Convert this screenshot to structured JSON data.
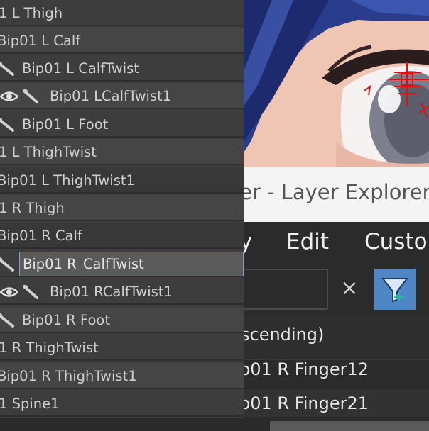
{
  "tree": {
    "rows": [
      {
        "label": "1 L Thigh"
      },
      {
        "label": "Bip01 L Calf"
      },
      {
        "label": "Bip01 L CalfTwist"
      },
      {
        "label": "Bip01 LCalfTwist1"
      },
      {
        "label": "Bip01 L Foot"
      },
      {
        "label": "1 L ThighTwist"
      },
      {
        "label": "Bip01 L ThighTwist1"
      },
      {
        "label": "1 R Thigh"
      },
      {
        "label": "Bip01 R Calf"
      },
      {
        "label_before_caret": "Bip01 R ",
        "label_after_caret": "CalfTwist"
      },
      {
        "label": "Bip01 RCalfTwist1"
      },
      {
        "label": "Bip01 R Foot"
      },
      {
        "label": "1 R ThighTwist"
      },
      {
        "label": "Bip01 R ThighTwist1"
      },
      {
        "label": "1 Spine1"
      }
    ]
  },
  "explorer": {
    "title": "er - Layer Explorer",
    "menu": {
      "item1": "y",
      "item2": "Edit",
      "item3": "Custor"
    },
    "clear_glyph": "×",
    "sort_label": "scending)",
    "rows": [
      {
        "label": "p01 R Finger12"
      },
      {
        "label": "p01 R Finger21"
      }
    ]
  },
  "colors": {
    "tree_bg": "#3d3d3d",
    "selection_border": "#8aa0c0",
    "filter_button": "#4f86c6",
    "gizmo_red": "#e01010"
  }
}
